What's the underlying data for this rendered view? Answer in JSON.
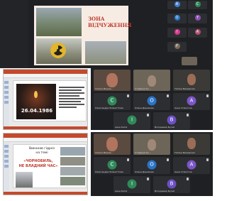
{
  "top_slide": {
    "title": "ЗОНА\nВІДЧУЖЕННЯ"
  },
  "top_sidebar_tiles": [
    {
      "initial": "A",
      "color": "#3f7fd4"
    },
    {
      "initial": "C",
      "color": "#2f8a5a"
    },
    {
      "initial": "O",
      "color": "#2a74c8"
    },
    {
      "initial": "I",
      "color": "#d33a8c"
    },
    {
      "initial": "P",
      "color": "#7a6c58"
    },
    {
      "initial": "Y",
      "color": "#8e4fb5"
    },
    {
      "initial": "A",
      "color": "#b54f6b"
    }
  ],
  "middle_slide": {
    "date": "26.04.1986"
  },
  "bottom_slide": {
    "heading": "Виконав гідрез\nна темі",
    "red_text": "«ЧОРНОБИЛЬ,\nНЕ ВЛАДНИЙ ЧАС»"
  },
  "participants_mid": [
    {
      "name": "Тетяна Ваниш...",
      "kind": "video",
      "bg": "#5b4a3f"
    },
    {
      "name": "Стефанія Ко...",
      "kind": "video",
      "bg": "#6c6558"
    },
    {
      "name": "Тетяна Ваневская",
      "kind": "video",
      "bg": "#3b3a37"
    },
    {
      "name": "Олександра Філюнтітова",
      "kind": "avatar",
      "initial": "C",
      "color": "#2f8a5a"
    },
    {
      "name": "Олена Денимова",
      "kind": "avatar",
      "initial": "O",
      "color": "#2a74c8"
    },
    {
      "name": "Анна Стрікотна",
      "kind": "avatar",
      "initial": "A",
      "color": "#7b56c8"
    },
    {
      "name": "Анна Катів",
      "kind": "avatar",
      "initial": "I",
      "color": "#2f8a5a"
    },
    {
      "name": "Володимир Бугай",
      "kind": "avatar",
      "initial": "B",
      "color": "#6b4fc4"
    }
  ],
  "participants_bot": [
    {
      "name": "Тетяна Ваниш...",
      "kind": "video",
      "bg": "#5b4a3f"
    },
    {
      "name": "Стефанія Ко...",
      "kind": "video",
      "bg": "#6c6558"
    },
    {
      "name": "Тетяна Ваневская",
      "kind": "video",
      "bg": "#3b3a37"
    },
    {
      "name": "Олександра Філюнтітова",
      "kind": "avatar",
      "initial": "C",
      "color": "#2f8a5a"
    },
    {
      "name": "Олена Денимова",
      "kind": "avatar",
      "initial": "O",
      "color": "#2a74c8"
    },
    {
      "name": "Анна Стрікотна",
      "kind": "avatar",
      "initial": "A",
      "color": "#7b56c8"
    },
    {
      "name": "Анна Катів",
      "kind": "avatar",
      "initial": "I",
      "color": "#2f8a5a"
    },
    {
      "name": "Володимир Бугай",
      "kind": "avatar",
      "initial": "B",
      "color": "#6b4fc4"
    }
  ]
}
